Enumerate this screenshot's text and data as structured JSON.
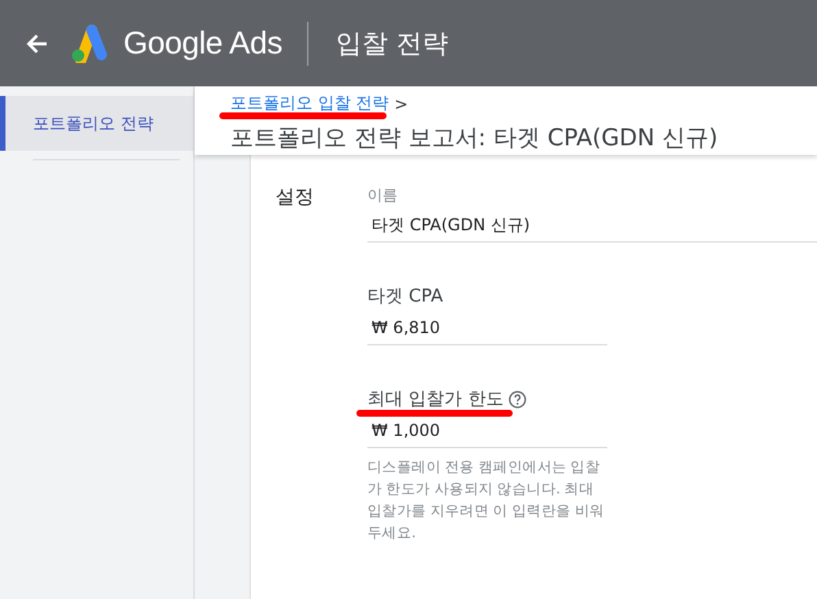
{
  "header": {
    "product": "Google Ads",
    "page_title": "입찰 전략"
  },
  "sidebar": {
    "items": [
      {
        "label": "포트폴리오 전략",
        "selected": true
      }
    ]
  },
  "breadcrumb": {
    "link": "포트폴리오 입찰 전략",
    "separator": ">",
    "underlined": true
  },
  "page_heading": "포트폴리오 전략 보고서: 타겟 CPA(GDN 신규)",
  "settings": {
    "section_label": "설정",
    "fields": [
      {
        "kind": "wide",
        "label": "이름",
        "value": "타겟 CPA(GDN 신규)",
        "help": false
      },
      {
        "kind": "narrow",
        "label": "타겟 CPA",
        "value": "₩ 6,810",
        "help": false
      },
      {
        "kind": "narrow",
        "label": "최대 입찰가 한도",
        "value": "₩ 1,000",
        "help": true,
        "underlined": true,
        "hint": "디스플레이 전용 캠페인에서는 입찰가 한도가 사용되지 않습니다. 최대 입찰가를 지우려면 이 입력란을 비워두세요."
      }
    ]
  }
}
